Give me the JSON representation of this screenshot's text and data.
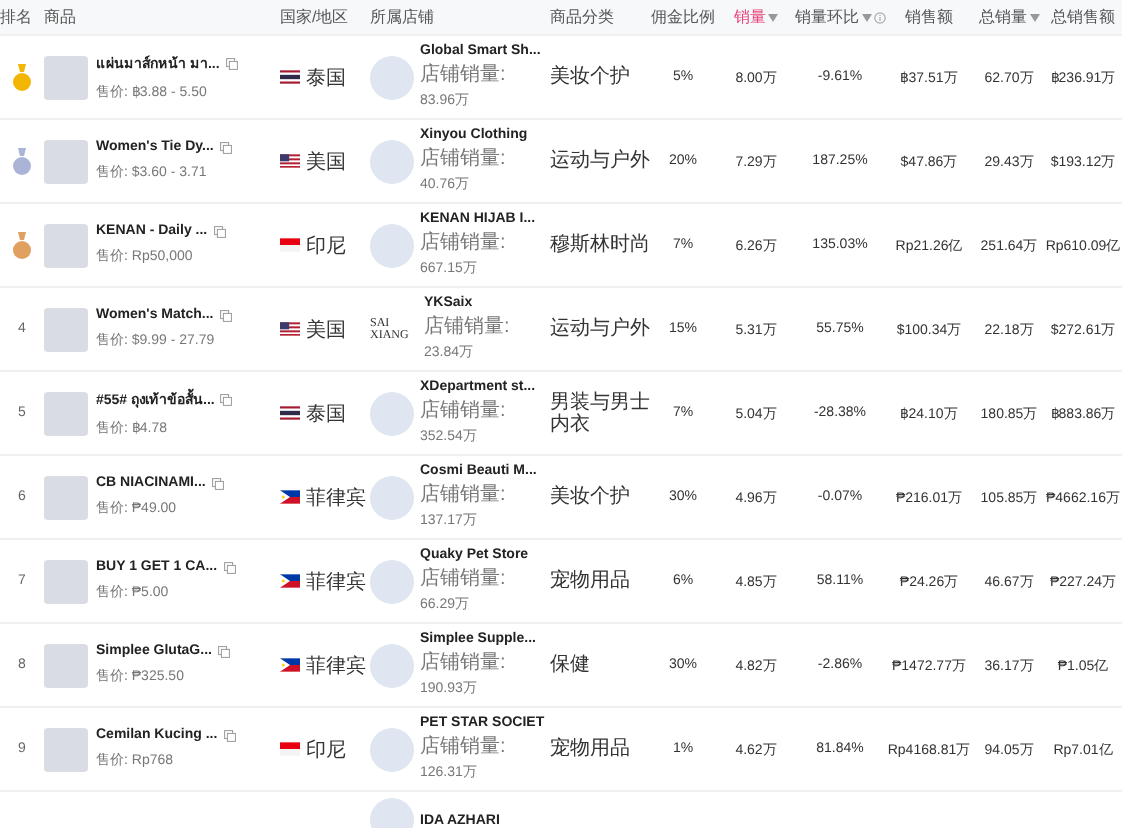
{
  "table": {
    "columns": [
      {
        "label": "排名"
      },
      {
        "label": "商品"
      },
      {
        "label": "国家/地区"
      },
      {
        "label": "所属店铺"
      },
      {
        "label": "商品分类"
      },
      {
        "label": "佣金比例"
      },
      {
        "label": "销量",
        "sortable": true,
        "selected": true
      },
      {
        "label": "销量环比",
        "sortable": true,
        "selected": false,
        "info": true
      },
      {
        "label": "销售额"
      },
      {
        "label": "总销量",
        "sortable": true,
        "selected": false
      },
      {
        "label": "总销售额"
      }
    ],
    "rows": [
      {
        "kind": "medal",
        "color": "#f2b705",
        "product": "แผ่นมาส์กหน้า มา...",
        "price": "售价: ฿3.88 - 5.50",
        "country": {
          "name": "泰国",
          "kind": "thailand"
        },
        "store": "Global Smart Sh...",
        "store_sales_label": "店铺销量:",
        "store_sales": "83.96万",
        "category": "美妆个护",
        "commission": "5%",
        "sales": "8.00万",
        "change": "-9.61%",
        "revenue": "฿37.51万",
        "total_sales": "62.70万",
        "total_revenue": "฿236.91万"
      },
      {
        "kind": "medal",
        "color": "#a9b4d6",
        "product": "Women's Tie Dy...",
        "price": "售价: $3.60 - 3.71",
        "country": {
          "name": "美国",
          "kind": "usa"
        },
        "store": "Xinyou Clothing",
        "store_sales_label": "店铺销量:",
        "store_sales": "40.76万",
        "category": "运动与户外",
        "commission": "20%",
        "sales": "7.29万",
        "change": "187.25%",
        "revenue": "$47.86万",
        "total_sales": "29.43万",
        "total_revenue": "$193.12万"
      },
      {
        "kind": "medal",
        "color": "#e0a060",
        "product": "KENAN - Daily ...",
        "price": "售价: Rp50,000",
        "country": {
          "name": "印尼",
          "kind": "indonesia"
        },
        "store": "KENAN HIJAB I...",
        "store_sales_label": "店铺销量:",
        "store_sales": "667.15万",
        "category": "穆斯林时尚",
        "commission": "7%",
        "sales": "6.26万",
        "change": "135.03%",
        "revenue": "Rp21.26亿",
        "total_sales": "251.64万",
        "total_revenue": "Rp610.09亿"
      },
      {
        "kind": "number",
        "rank": "4",
        "product": "Women's Match...",
        "price": "售价: $9.99 - 27.79",
        "country": {
          "name": "美国",
          "kind": "usa"
        },
        "store_logo_text": "SAI XIANG",
        "store": "YKSaix",
        "store_sales_label": "店铺销量:",
        "store_sales": "23.84万",
        "category": "运动与户外",
        "commission": "15%",
        "sales": "5.31万",
        "change": "55.75%",
        "revenue": "$100.34万",
        "total_sales": "22.18万",
        "total_revenue": "$272.61万"
      },
      {
        "kind": "number",
        "rank": "5",
        "product": "#55# ถุงเท้าข้อสั้น...",
        "price": "售价: ฿4.78",
        "country": {
          "name": "泰国",
          "kind": "thailand"
        },
        "store": "XDepartment st...",
        "store_sales_label": "店铺销量:",
        "store_sales": "352.54万",
        "category": "男装与男士内衣",
        "commission": "7%",
        "sales": "5.04万",
        "change": "-28.38%",
        "revenue": "฿24.10万",
        "total_sales": "180.85万",
        "total_revenue": "฿883.86万"
      },
      {
        "kind": "number",
        "rank": "6",
        "product": "CB NIACINAMI...",
        "price": "售价: ₱49.00",
        "country": {
          "name": "菲律宾",
          "kind": "philippines"
        },
        "store": "Cosmi Beauti M...",
        "store_sales_label": "店铺销量:",
        "store_sales": "137.17万",
        "category": "美妆个护",
        "commission": "30%",
        "sales": "4.96万",
        "change": "-0.07%",
        "revenue": "₱216.01万",
        "total_sales": "105.85万",
        "total_revenue": "₱4662.16万"
      },
      {
        "kind": "number",
        "rank": "7",
        "product": "BUY 1 GET 1 CA...",
        "price": "售价: ₱5.00",
        "country": {
          "name": "菲律宾",
          "kind": "philippines"
        },
        "store": "Quaky Pet Store",
        "store_sales_label": "店铺销量:",
        "store_sales": "66.29万",
        "category": "宠物用品",
        "commission": "6%",
        "sales": "4.85万",
        "change": "58.11%",
        "revenue": "₱24.26万",
        "total_sales": "46.67万",
        "total_revenue": "₱227.24万"
      },
      {
        "kind": "number",
        "rank": "8",
        "product": "Simplee GlutaG...",
        "price": "售价: ₱325.50",
        "country": {
          "name": "菲律宾",
          "kind": "philippines"
        },
        "store": "Simplee Supple...",
        "store_sales_label": "店铺销量:",
        "store_sales": "190.93万",
        "category": "保健",
        "commission": "30%",
        "sales": "4.82万",
        "change": "-2.86%",
        "revenue": "₱1472.77万",
        "total_sales": "36.17万",
        "total_revenue": "₱1.05亿"
      },
      {
        "kind": "number",
        "rank": "9",
        "product": "Cemilan Kucing ...",
        "price": "售价: Rp768",
        "country": {
          "name": "印尼",
          "kind": "indonesia"
        },
        "store": "PET STAR SOCIET",
        "store_sales_label": "店铺销量:",
        "store_sales": "126.31万",
        "category": "宠物用品",
        "commission": "1%",
        "sales": "4.62万",
        "change": "81.84%",
        "revenue": "Rp4168.81万",
        "total_sales": "94.05万",
        "total_revenue": "Rp7.01亿"
      },
      {
        "kind": "partial",
        "store": "IDA AZHARI"
      }
    ]
  }
}
